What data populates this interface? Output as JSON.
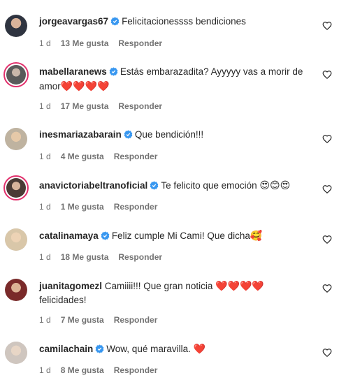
{
  "comments": [
    {
      "username": "jorgeavargas67",
      "text": "Felicitacionessss bendiciones",
      "time": "1 d",
      "likes": "13 Me gusta",
      "reply": "Responder"
    },
    {
      "username": "mabellaranews",
      "text": "Estás embarazadita? Ayyyyy vas a morir de amor",
      "emoji": "❤️❤️❤️❤️",
      "time": "1 d",
      "likes": "17 Me gusta",
      "reply": "Responder"
    },
    {
      "username": "inesmariazabarain",
      "text": "Que bendición!!!",
      "time": "1 d",
      "likes": "4 Me gusta",
      "reply": "Responder"
    },
    {
      "username": "anavictoriabeltranoficial",
      "text": "Te felicito que emoción",
      "emoji": "😍😊😍",
      "time": "1 d",
      "likes": "1 Me gusta",
      "reply": "Responder"
    },
    {
      "username": "catalinamaya",
      "text": "Feliz cumple Mi Cami! Que dicha",
      "emoji": "🥰",
      "time": "1 d",
      "likes": "18 Me gusta",
      "reply": "Responder"
    },
    {
      "username": "juanitagomezl",
      "text": "Camiiii!!! Que gran noticia",
      "emoji": "❤️❤️❤️❤️",
      "text2": "felicidades!",
      "time": "1 d",
      "likes": "7 Me gusta",
      "reply": "Responder"
    },
    {
      "username": "camilachain",
      "text": "Wow, qué maravilla.",
      "emoji": "❤️",
      "time": "1 d",
      "likes": "8 Me gusta",
      "reply": "Responder"
    }
  ],
  "colors": {
    "verified": "#3897f0",
    "meta": "#737373",
    "heart": "#e0162b"
  }
}
